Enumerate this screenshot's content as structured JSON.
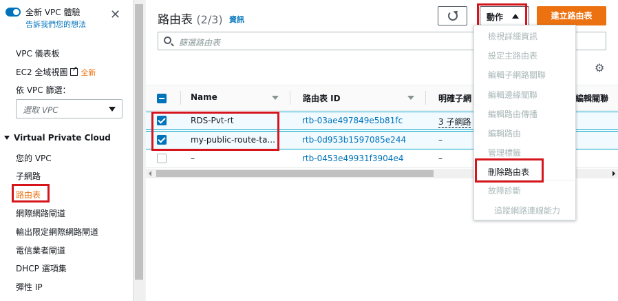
{
  "sidebar": {
    "toggle_title": "全新 VPC 體驗",
    "toggle_link": "告訴我們您的想法",
    "nav": {
      "dashboard": "VPC 儀表板",
      "ec2_global": "EC2 全域視圖",
      "ec2_global_badge": "全新",
      "filter_label": "依 VPC 篩選：",
      "filter_placeholder": "選取 VPC",
      "section": "Virtual Private Cloud",
      "items": [
        "您的 VPC",
        "子網路",
        "路由表",
        "網際網路閘道",
        "輸出限定網際網路閘道",
        "電信業者閘道",
        "DHCP 選項集",
        "彈性 IP"
      ]
    }
  },
  "header": {
    "title": "路由表",
    "count": "(2/3)",
    "info": "資訊",
    "actions_label": "動作",
    "create_label": "建立路由表"
  },
  "search": {
    "placeholder": "篩選路由表"
  },
  "table": {
    "columns": {
      "name": "Name",
      "route_table_id": "路由表 ID",
      "explicit_subnet": "明確子網",
      "edge": "編輯關聯"
    },
    "rows": [
      {
        "name": "RDS-Pvt-rt",
        "id": "rtb-03ae497849e5b81fc",
        "subnet": "3 子網路",
        "selected": true
      },
      {
        "name": "my-public-route-ta...",
        "id": "rtb-0d953b1597085e244",
        "subnet": "–",
        "selected": true
      },
      {
        "name": "–",
        "id": "rtb-0453e49931f3904e4",
        "subnet": "–",
        "selected": false
      }
    ]
  },
  "actions_menu": {
    "items": [
      "檢視詳細資訊",
      "設定主路由表",
      "編輯子網路關聯",
      "編輯邊緣關聯",
      "編輯路由傳播",
      "編輯路由",
      "管理標籤",
      "刪除路由表",
      "故障診斷"
    ],
    "sub_item": "追蹤網路連線能力"
  },
  "colors": {
    "accent": "#0073bb",
    "brand_orange": "#ec7211",
    "highlight_red": "#d5141c"
  }
}
